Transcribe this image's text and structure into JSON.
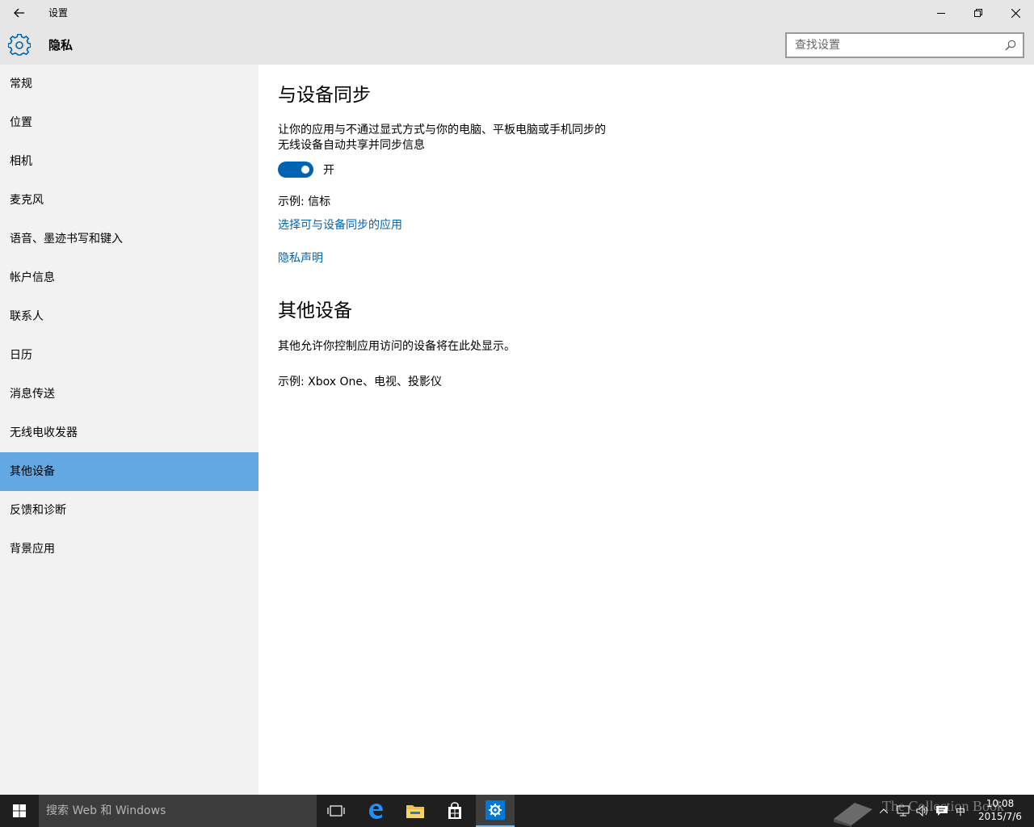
{
  "window": {
    "title": "设置",
    "back_icon": "back-arrow-icon",
    "minimize_icon": "minimize-icon",
    "maximize_icon": "restore-icon",
    "close_icon": "close-icon"
  },
  "header": {
    "title": "隐私",
    "icon": "gear-icon",
    "search_placeholder": "查找设置"
  },
  "sidebar": {
    "active_index": 10,
    "items": [
      {
        "label": "常规"
      },
      {
        "label": "位置"
      },
      {
        "label": "相机"
      },
      {
        "label": "麦克风"
      },
      {
        "label": "语音、墨迹书写和键入"
      },
      {
        "label": "帐户信息"
      },
      {
        "label": "联系人"
      },
      {
        "label": "日历"
      },
      {
        "label": "消息传送"
      },
      {
        "label": "无线电收发器"
      },
      {
        "label": "其他设备"
      },
      {
        "label": "反馈和诊断"
      },
      {
        "label": "背景应用"
      }
    ]
  },
  "main": {
    "sync": {
      "heading": "与设备同步",
      "description_line1": "让你的应用与不通过显式方式与你的电脑、平板电脑或手机同步的",
      "description_line2": "无线设备自动共享并同步信息",
      "toggle_state": "on",
      "toggle_label": "开",
      "example": "示例: 信标",
      "choose_apps_link": "选择可与设备同步的应用",
      "privacy_link": "隐私声明"
    },
    "other": {
      "heading": "其他设备",
      "description": "其他允许你控制应用访问的设备将在此处显示。",
      "example": "示例: Xbox One、电视、投影仪"
    }
  },
  "taskbar": {
    "search_text": "搜索 Web 和 Windows",
    "time": "10:08",
    "date": "2015/7/6",
    "ime": "中",
    "watermark": "The Collection Book",
    "accent": "#0078d7"
  },
  "colors": {
    "accent_blue": "#0063b1",
    "sidebar_selected": "#63a8e3",
    "chrome_gray": "#e6e6e6",
    "sidebar_bg": "#f2f2f2",
    "taskbar": "#1f1f1f"
  }
}
